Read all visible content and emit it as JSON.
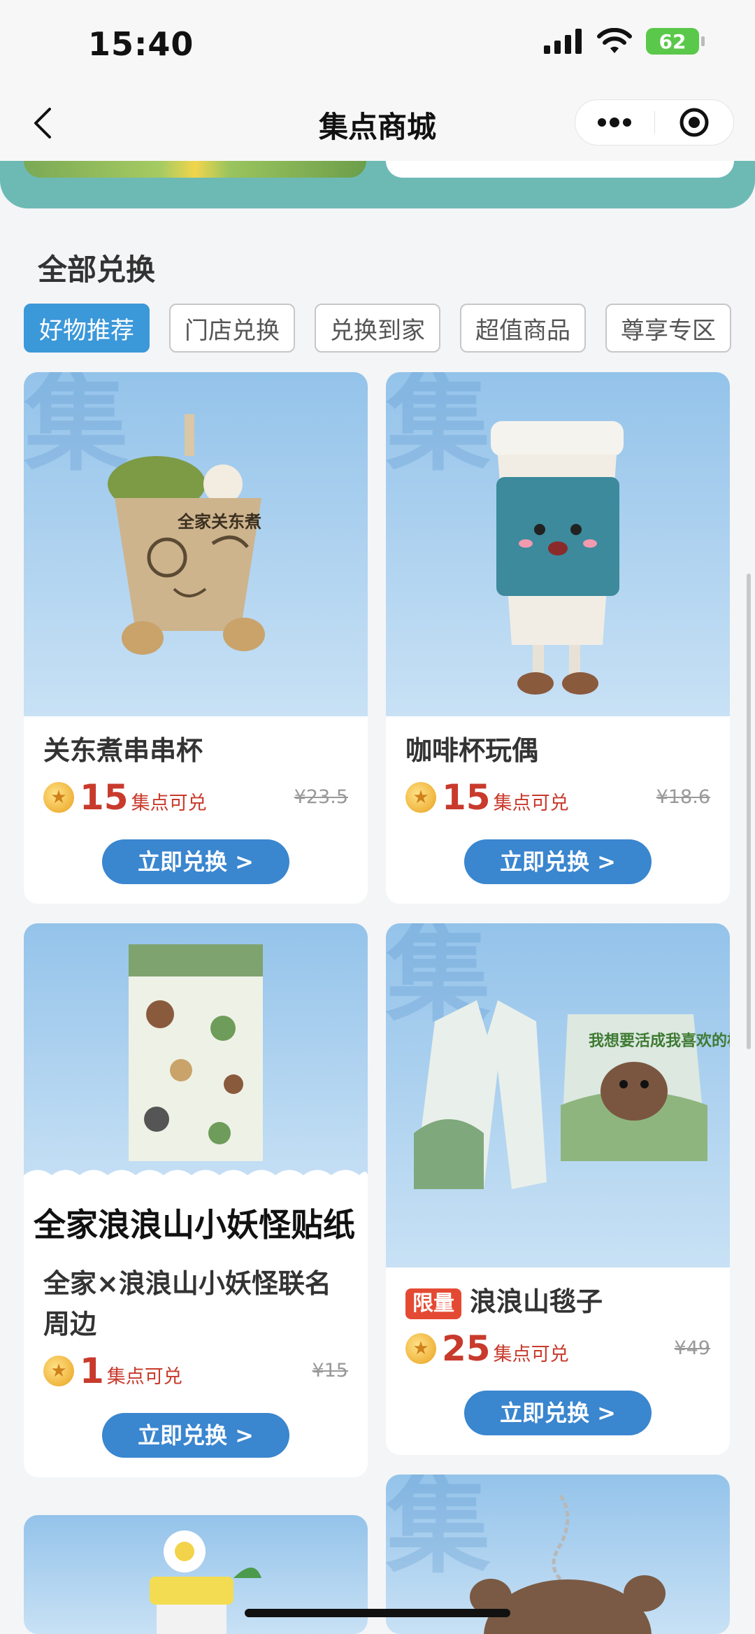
{
  "status_bar": {
    "time": "15:40",
    "battery": "62"
  },
  "nav": {
    "title": "集点商城"
  },
  "section": {
    "title": "全部兑换"
  },
  "tabs": [
    {
      "label": "好物推荐",
      "active": true
    },
    {
      "label": "门店兑换",
      "active": false
    },
    {
      "label": "兑换到家",
      "active": false
    },
    {
      "label": "超值商品",
      "active": false
    },
    {
      "label": "尊享专区",
      "active": false
    }
  ],
  "watermark_char": "集",
  "products": [
    {
      "title": "关东煮串串杯",
      "points": "15",
      "points_label": "集点可兑",
      "original_price": "¥23.5",
      "button": "立即兑换 >"
    },
    {
      "title": "咖啡杯玩偶",
      "points": "15",
      "points_label": "集点可兑",
      "original_price": "¥18.6",
      "button": "立即兑换 >"
    },
    {
      "image_caption": "全家浪浪山小妖怪贴纸",
      "title": "全家×浪浪山小妖怪联名周边",
      "points": "1",
      "points_label": "集点可兑",
      "original_price": "¥15",
      "button": "立即兑换 >"
    },
    {
      "badge": "限量",
      "title": "浪浪山毯子",
      "points": "25",
      "points_label": "集点可兑",
      "original_price": "¥49",
      "button": "立即兑换 >"
    }
  ],
  "product_images": {
    "cup_label": "全家关东煮",
    "blanket_text": "我想要活成我喜欢的样子"
  },
  "colors": {
    "accent": "#3a86cf",
    "tab_active": "#3b98d9",
    "price": "#c83a2c",
    "banner": "#6dbab5"
  }
}
